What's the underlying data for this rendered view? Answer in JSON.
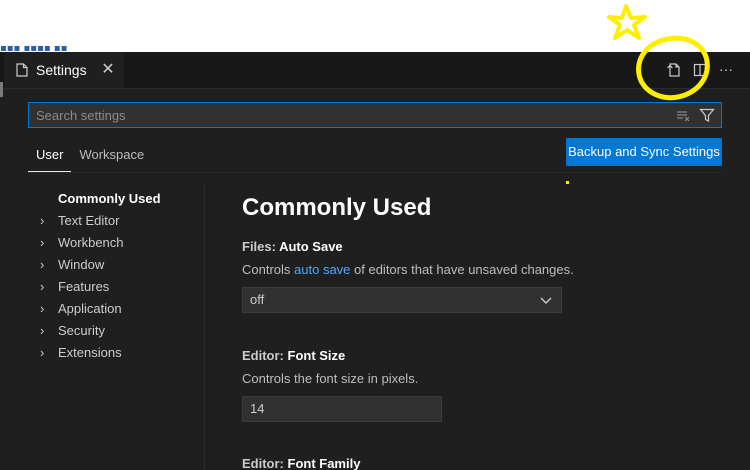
{
  "tab": {
    "label": "Settings",
    "close_glyph": "✕"
  },
  "actions": {
    "open_json_icon": "open-settings-json-icon",
    "split_icon": "split-editor-icon",
    "more_glyph": "···"
  },
  "search": {
    "placeholder": "Search settings",
    "value": ""
  },
  "scope_tabs": [
    "User",
    "Workspace"
  ],
  "sync_button": "Backup and Sync Settings",
  "toc": [
    "Commonly Used",
    "Text Editor",
    "Workbench",
    "Window",
    "Features",
    "Application",
    "Security",
    "Extensions"
  ],
  "section_title": "Commonly Used",
  "settings": {
    "auto_save": {
      "category": "Files: ",
      "key": "Auto Save",
      "desc_before": "Controls ",
      "desc_link": "auto save",
      "desc_after": " of editors that have unsaved changes.",
      "value": "off"
    },
    "font_size": {
      "category": "Editor: ",
      "key": "Font Size",
      "desc": "Controls the font size in pixels.",
      "value": "14"
    },
    "font_family": {
      "category": "Editor: ",
      "key": "Font Family"
    }
  },
  "colors": {
    "accent": "#0078d4",
    "link": "#4daafc",
    "annotation": "#ffee00",
    "background": "#1f1f1f"
  }
}
